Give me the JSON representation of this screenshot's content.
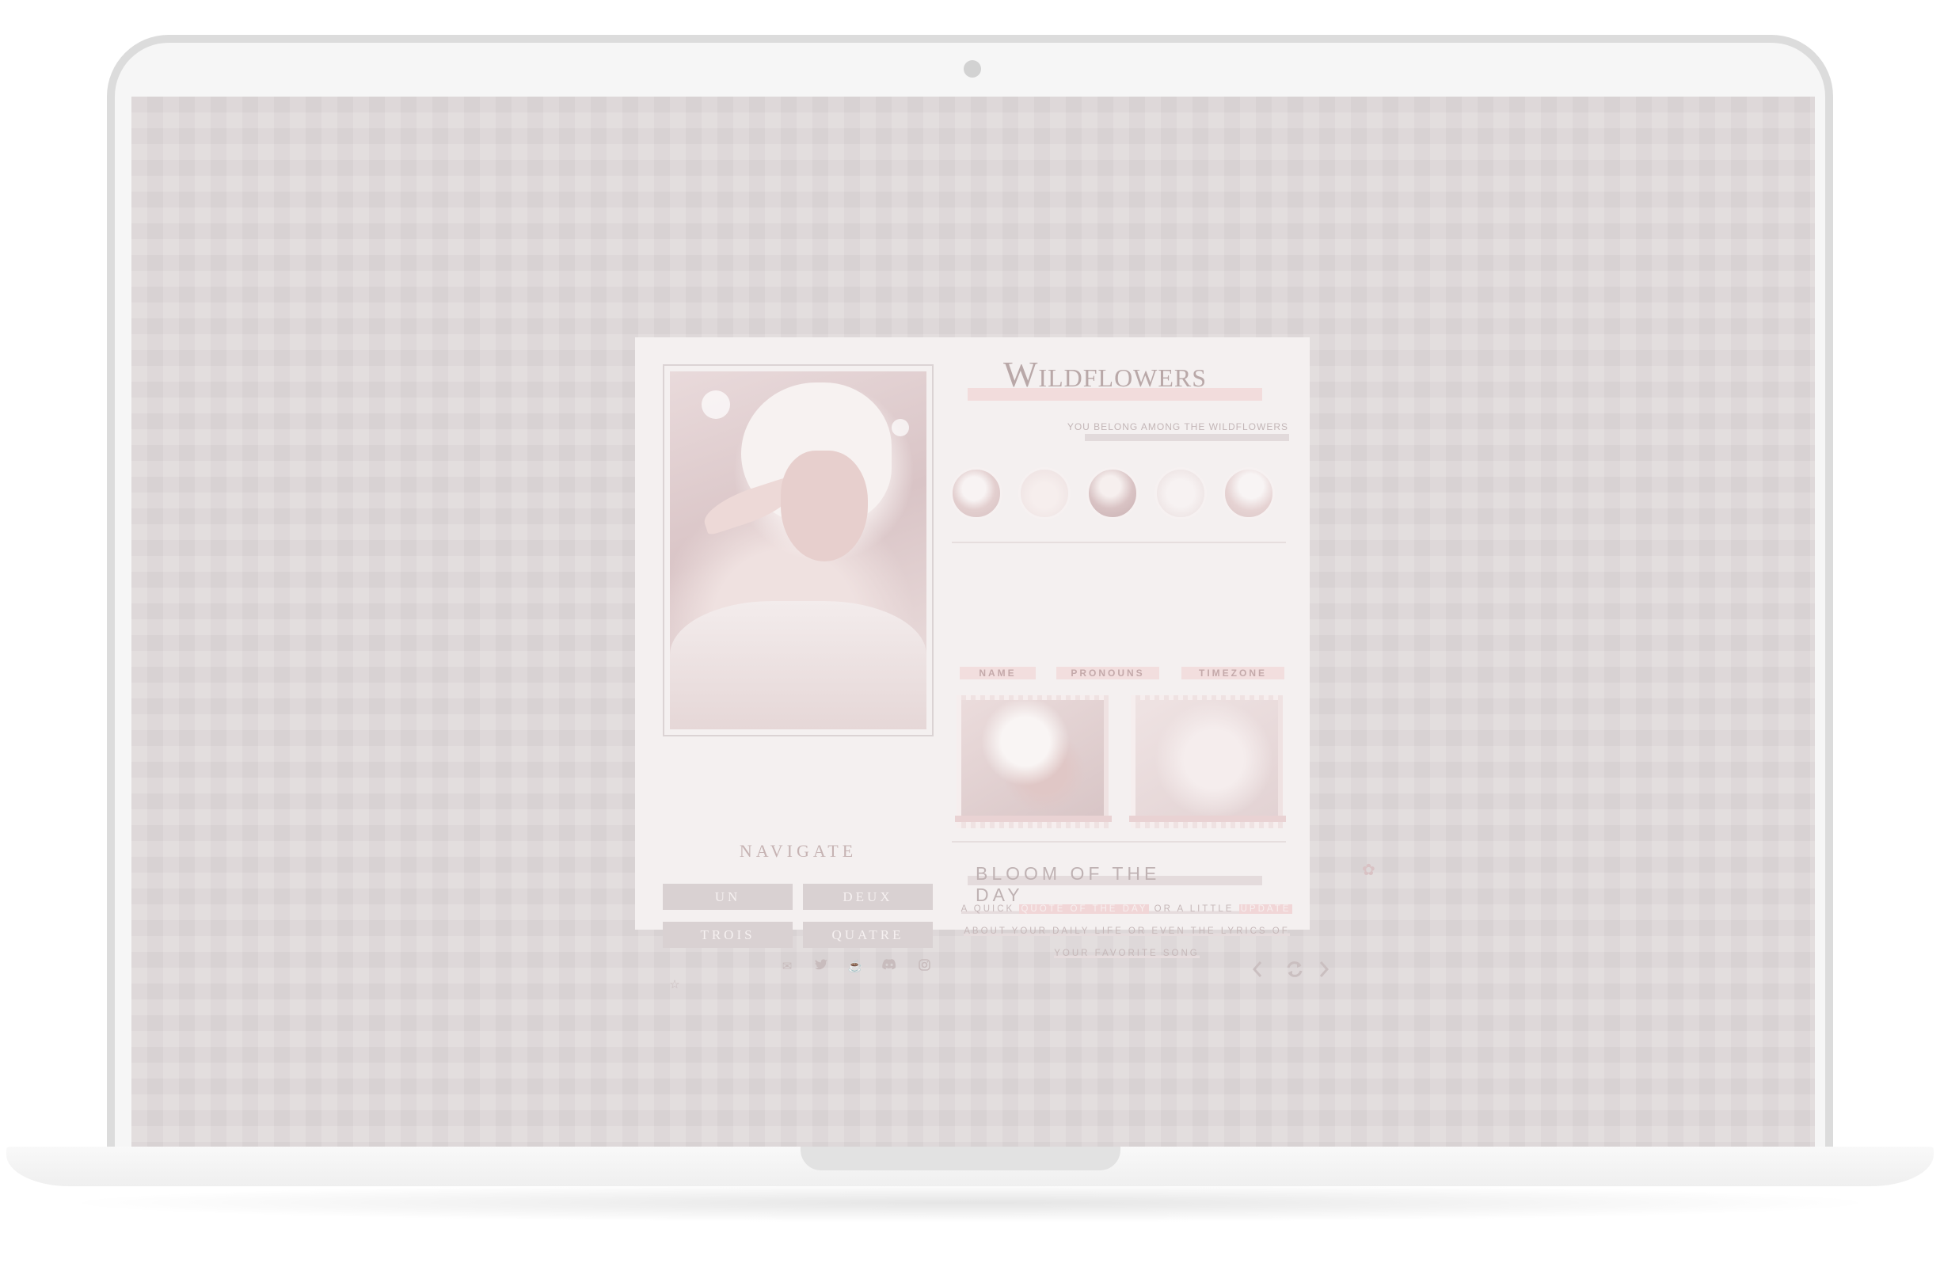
{
  "theme": {
    "title": "Wildflowers",
    "subtitle": "you belong among the wildflowers",
    "navigate_label": "NAVIGATE",
    "nav_buttons": [
      "UN",
      "DEUX",
      "TROIS",
      "QUATRE"
    ],
    "info_tabs": [
      "NAME",
      "PRONOUNS",
      "TIMEZONE"
    ],
    "bloom_title": "BLOOM OF THE DAY",
    "bloom_text": {
      "p1": "A QUICK ",
      "hl1": "QUOTE OF THE DAY",
      "p2": " OR A LITTLE ",
      "hl2": "UPDATE",
      "p3": "ABOUT YOUR DAILY LIFE OR EVEN THE LYRICS OF",
      "p4": "YOUR FAVORITE SONG"
    }
  },
  "icons": {
    "social": [
      "mail-icon",
      "twitter-icon",
      "kofi-icon",
      "discord-icon",
      "instagram-icon"
    ],
    "star": "star-icon",
    "flower": "flower-icon",
    "controls": [
      "chevron-left-icon",
      "refresh-icon",
      "chevron-right-icon"
    ]
  },
  "colors": {
    "card_bg": "#f4f0f0",
    "button_bg": "#d9d1d2",
    "accent_pink": "#f2dcdc",
    "screen_bg": "#d8d2d3"
  }
}
